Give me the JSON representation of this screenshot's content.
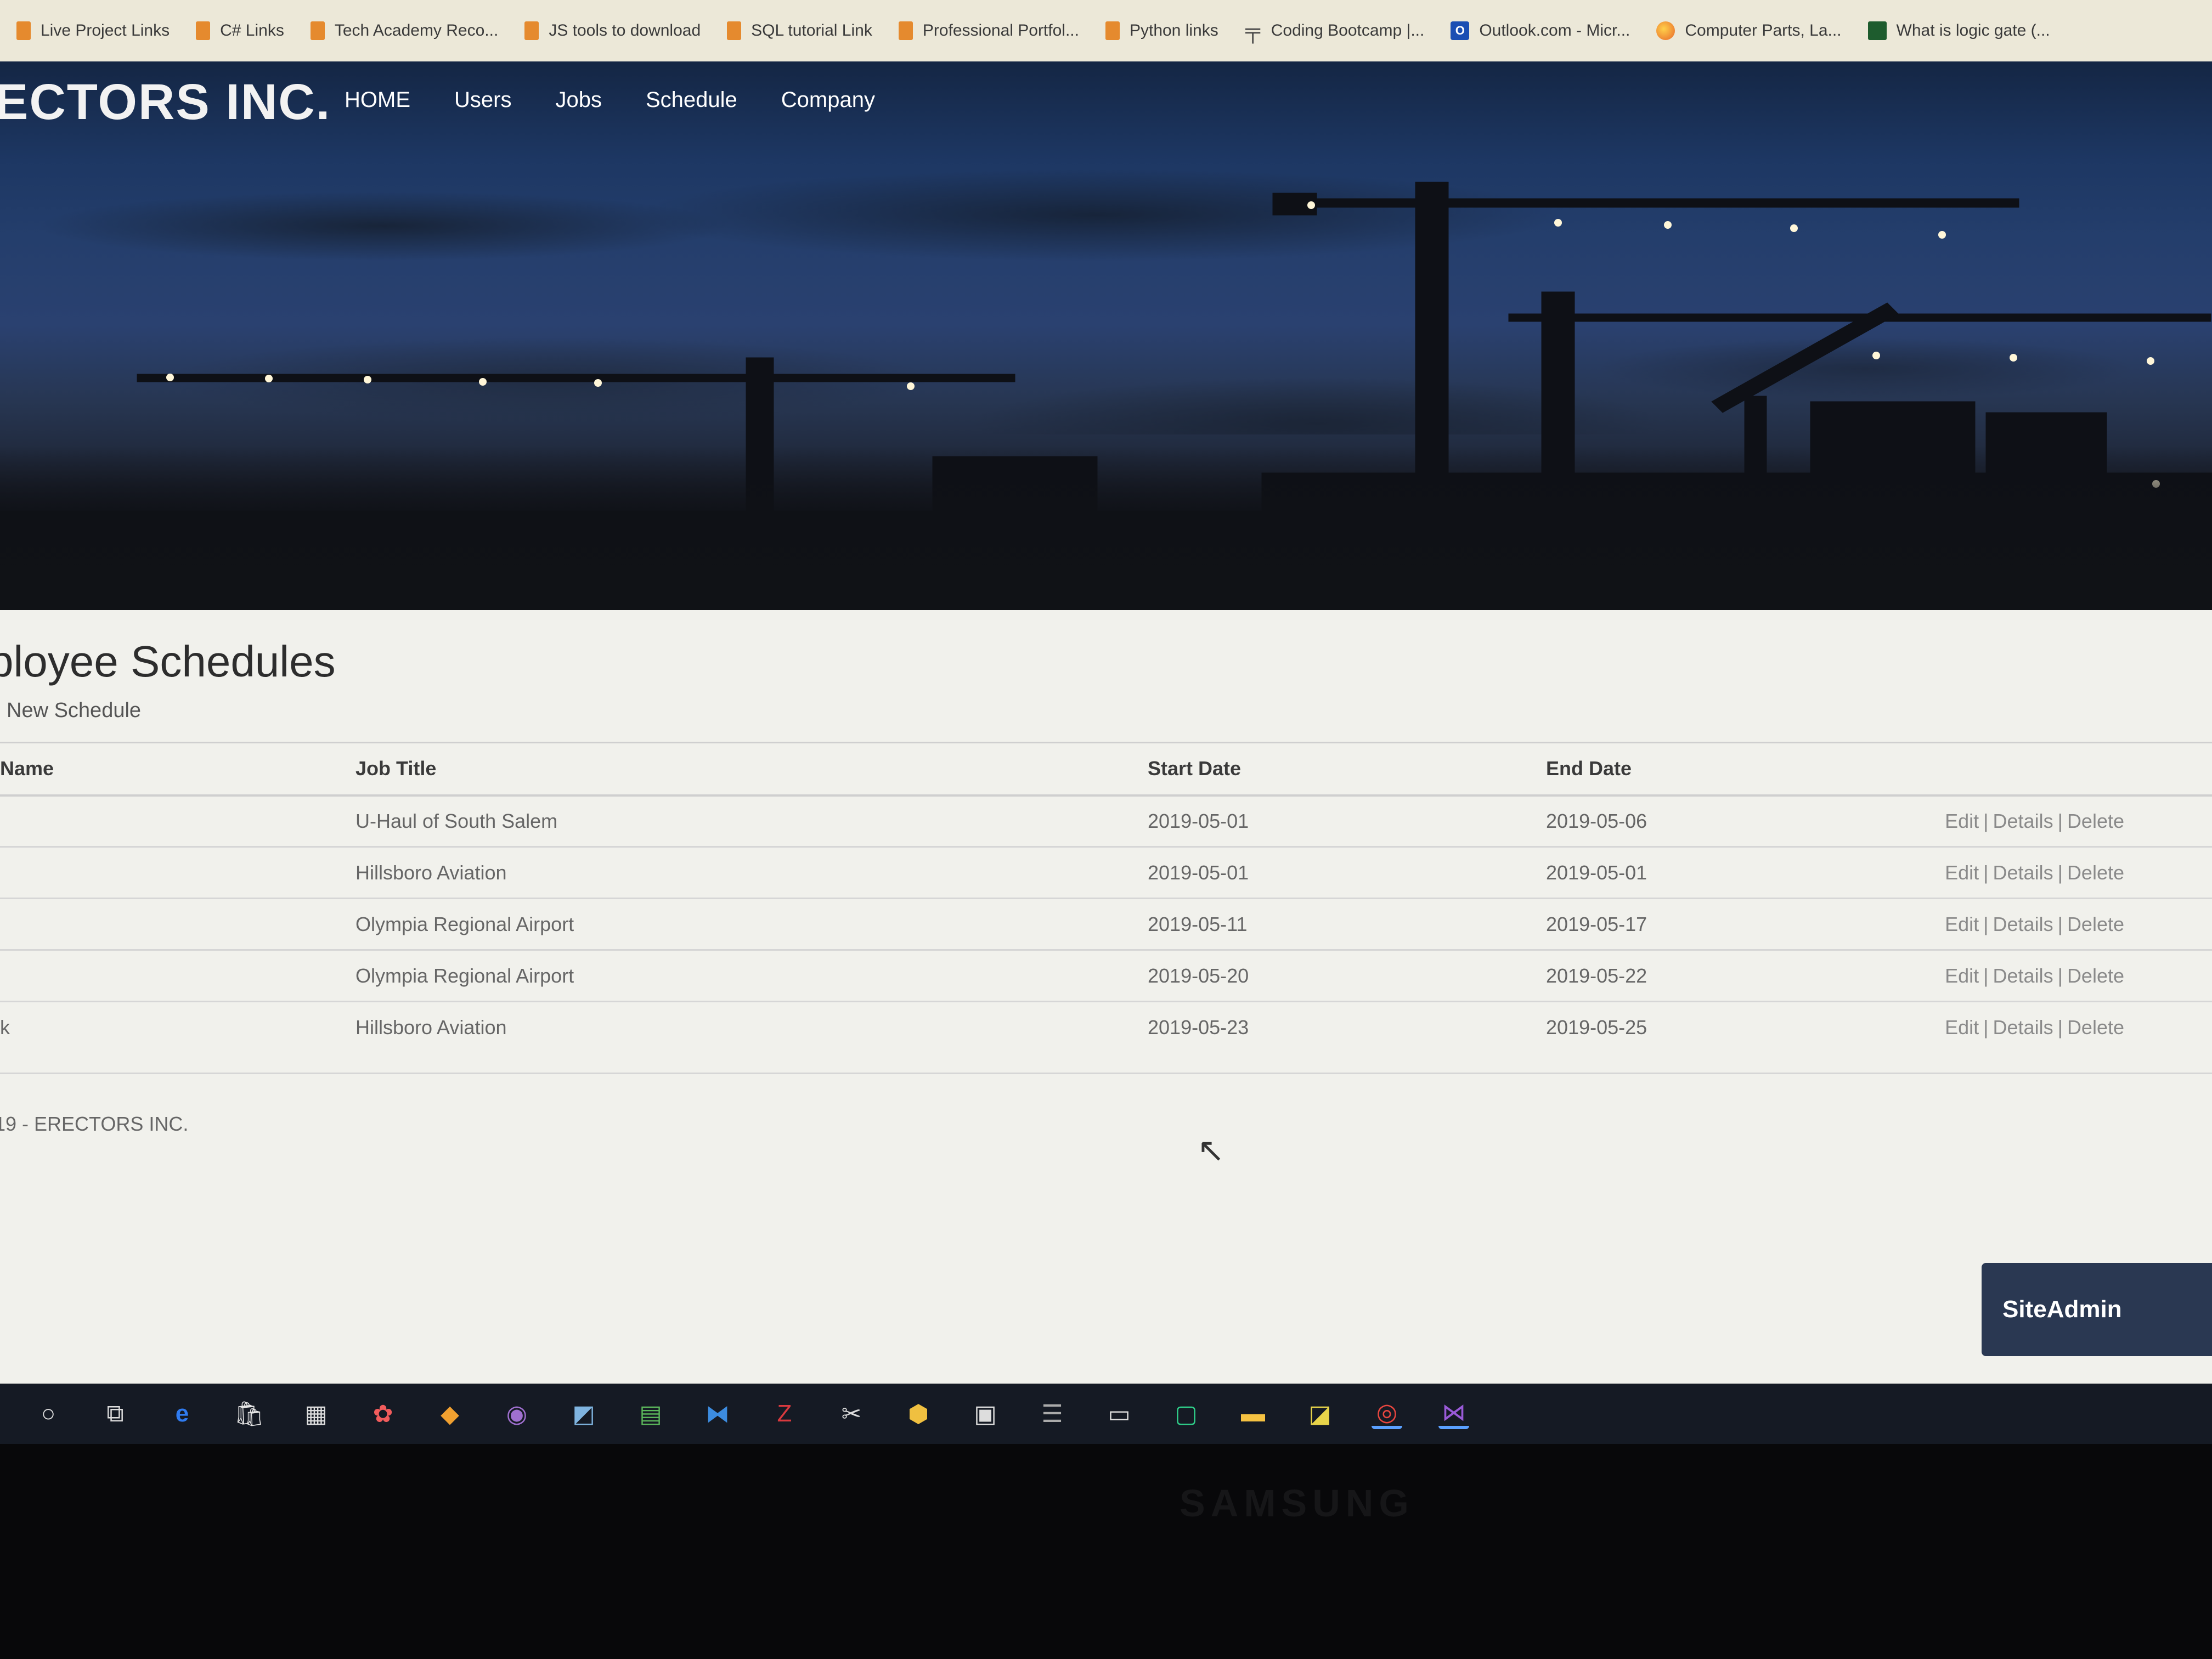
{
  "bookmarks": [
    {
      "label": "Live Project Links",
      "icon": "folder-icon"
    },
    {
      "label": "C# Links",
      "icon": "folder-icon"
    },
    {
      "label": "Tech Academy Reco...",
      "icon": "folder-icon"
    },
    {
      "label": "JS tools to download",
      "icon": "folder-icon"
    },
    {
      "label": "SQL tutorial Link",
      "icon": "folder-icon"
    },
    {
      "label": "Professional Portfol...",
      "icon": "folder-icon"
    },
    {
      "label": "Python links",
      "icon": "folder-icon"
    },
    {
      "label": "Coding Bootcamp |...",
      "icon": "bootcamp-icon"
    },
    {
      "label": "Outlook.com - Micr...",
      "icon": "outlook-icon"
    },
    {
      "label": "Computer Parts, La...",
      "icon": "computer-parts-icon"
    },
    {
      "label": "What is logic gate (...",
      "icon": "logic-gate-icon"
    }
  ],
  "navbar": {
    "brand": "ECTORS INC.",
    "links": [
      "HOME",
      "Users",
      "Jobs",
      "Schedule",
      "Company"
    ]
  },
  "main": {
    "title": "ployee Schedules",
    "create_link": "New Schedule",
    "columns": [
      "Name",
      "Job Title",
      "Start Date",
      "End Date"
    ],
    "rows": [
      {
        "name": "",
        "job": "U-Haul of South Salem",
        "start": "2019-05-01",
        "end": "2019-05-06"
      },
      {
        "name": "",
        "job": "Hillsboro Aviation",
        "start": "2019-05-01",
        "end": "2019-05-01"
      },
      {
        "name": "",
        "job": "Olympia Regional Airport",
        "start": "2019-05-11",
        "end": "2019-05-17"
      },
      {
        "name": "",
        "job": "Olympia Regional Airport",
        "start": "2019-05-20",
        "end": "2019-05-22"
      },
      {
        "name": "k",
        "job": "Hillsboro Aviation",
        "start": "2019-05-23",
        "end": "2019-05-25"
      }
    ],
    "actions": {
      "edit": "Edit",
      "details": "Details",
      "delete": "Delete",
      "separator": "|"
    }
  },
  "footer": {
    "text": "19 - ERECTORS INC."
  },
  "siteadmin": {
    "label": "SiteAdmin"
  },
  "taskbar": {
    "items": [
      "search-circle-icon",
      "task-view-icon",
      "edge-icon",
      "store-icon",
      "calculator-icon",
      "paint-icon",
      "git-icon",
      "app-circle-icon",
      "notes-icon",
      "spreadsheet-icon",
      "vscode-icon",
      "filezilla-icon",
      "tools-icon",
      "python-icon",
      "document-icon",
      "database-icon",
      "terminal-icon",
      "pycharm-icon",
      "file-explorer-icon",
      "sticky-notes-icon",
      "chrome-icon",
      "visual-studio-icon"
    ]
  },
  "monitor_brand": "SAMSUNG",
  "colors": {
    "bookmark_bar": "#ece8d8",
    "content_bg": "#f1f1ec",
    "siteadmin_bg": "#2a3852",
    "taskbar": "#151a24"
  }
}
